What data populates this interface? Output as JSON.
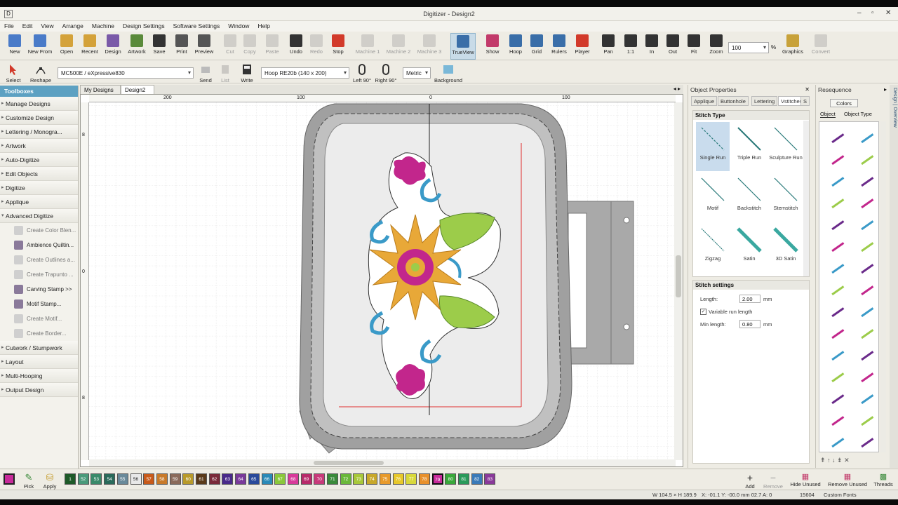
{
  "window": {
    "title": "Digitizer - Design2",
    "minimize": "–",
    "maximize": "▫",
    "close": "✕"
  },
  "menu": [
    "File",
    "Edit",
    "View",
    "Arrange",
    "Machine",
    "Design Settings",
    "Software Settings",
    "Window",
    "Help"
  ],
  "toolbar": [
    {
      "label": "New",
      "icon": "new-icon",
      "color": "#4a7bc8"
    },
    {
      "label": "New From",
      "icon": "new-from-icon",
      "color": "#4a7bc8"
    },
    {
      "label": "Open",
      "icon": "open-folder-icon",
      "color": "#d4a23a"
    },
    {
      "label": "Recent",
      "icon": "recent-icon",
      "color": "#d4a23a"
    },
    {
      "label": "Design",
      "icon": "design-icon",
      "color": "#7a5aa8"
    },
    {
      "label": "Artwork",
      "icon": "artwork-icon",
      "color": "#5a8a3a"
    },
    {
      "label": "Save",
      "icon": "save-icon",
      "color": "#333333"
    },
    {
      "label": "Print",
      "icon": "print-icon",
      "color": "#555555"
    },
    {
      "label": "Preview",
      "icon": "preview-icon",
      "color": "#555555"
    },
    {
      "label": "Cut",
      "icon": "cut-icon",
      "color": "#999999",
      "disabled": true
    },
    {
      "label": "Copy",
      "icon": "copy-icon",
      "color": "#999999",
      "disabled": true
    },
    {
      "label": "Paste",
      "icon": "paste-icon",
      "color": "#999999",
      "disabled": true
    },
    {
      "label": "Undo",
      "icon": "undo-icon",
      "color": "#333333"
    },
    {
      "label": "Redo",
      "icon": "redo-icon",
      "color": "#999999",
      "disabled": true
    },
    {
      "label": "Stop",
      "icon": "stop-icon",
      "color": "#d23a2a"
    },
    {
      "label": "Machine 1",
      "icon": "machine-icon",
      "color": "#999999",
      "disabled": true
    },
    {
      "label": "Machine 2",
      "icon": "machine-icon",
      "color": "#999999",
      "disabled": true
    },
    {
      "label": "Machine 3",
      "icon": "machine-icon",
      "color": "#999999",
      "disabled": true
    },
    {
      "label": "TrueView",
      "icon": "trueview-icon",
      "color": "#3a6ea8",
      "active": true
    },
    {
      "label": "Show",
      "icon": "show-icon",
      "color": "#c23a6a"
    },
    {
      "label": "Hoop",
      "icon": "hoop-icon",
      "color": "#3a6ea8"
    },
    {
      "label": "Grid",
      "icon": "grid-icon",
      "color": "#3a6ea8"
    },
    {
      "label": "Rulers",
      "icon": "rulers-icon",
      "color": "#3a6ea8"
    },
    {
      "label": "Player",
      "icon": "player-icon",
      "color": "#d23a2a"
    },
    {
      "label": "Pan",
      "icon": "pan-hand-icon",
      "color": "#333333"
    },
    {
      "label": "1:1",
      "icon": "zoom-actual-icon",
      "color": "#333333"
    },
    {
      "label": "In",
      "icon": "zoom-in-icon",
      "color": "#333333"
    },
    {
      "label": "Out",
      "icon": "zoom-out-icon",
      "color": "#333333"
    },
    {
      "label": "Fit",
      "icon": "zoom-fit-icon",
      "color": "#333333"
    },
    {
      "label": "Zoom",
      "icon": "zoom-icon",
      "color": "#333333"
    },
    {
      "label": "Graphics",
      "icon": "graphics-icon",
      "color": "#c8a23a"
    },
    {
      "label": "Convert",
      "icon": "convert-icon",
      "color": "#999999",
      "disabled": true
    }
  ],
  "zoom_value": "100",
  "zoom_unit": "%",
  "toolbar2": {
    "select_label": "Select",
    "reshape_label": "Reshape",
    "machine_combo": "MC500E / eXpressive830",
    "send_label": "Send",
    "list_label": "List",
    "write_label": "Write",
    "hoop_combo": "Hoop RE20b (140 x 200)",
    "left90_label": "Left 90°",
    "right90_label": "Right 90°",
    "units_combo": "Metric",
    "background_label": "Background"
  },
  "toolbox": {
    "header": "Toolboxes",
    "categories_top": [
      "Manage Designs",
      "Customize Design",
      "Lettering / Monogra...",
      "Artwork",
      "Auto-Digitize",
      "Edit Objects",
      "Digitize",
      "Applique"
    ],
    "advanced": "Advanced Digitize",
    "advanced_items": [
      {
        "label": "Create Color Blen...",
        "icon": "color-blend-icon",
        "enabled": false
      },
      {
        "label": "Ambience Quiltin...",
        "icon": "quilting-icon",
        "enabled": true
      },
      {
        "label": "Create Outlines a...",
        "icon": "outlines-icon",
        "enabled": false
      },
      {
        "label": "Create Trapunto ...",
        "icon": "trapunto-icon",
        "enabled": false
      },
      {
        "label": "Carving Stamp >>",
        "icon": "carving-stamp-icon",
        "enabled": true
      },
      {
        "label": "Motif Stamp...",
        "icon": "motif-stamp-icon",
        "enabled": true
      },
      {
        "label": "Create Motif...",
        "icon": "create-motif-icon",
        "enabled": false
      },
      {
        "label": "Create Border...",
        "icon": "create-border-icon",
        "enabled": false
      }
    ],
    "categories_bottom": [
      "Cutwork / Stumpwork",
      "Layout",
      "Multi-Hooping",
      "Output Design"
    ]
  },
  "doc_tabs": [
    {
      "label": "My Designs"
    },
    {
      "label": "Design2",
      "active": true
    }
  ],
  "ruler_labels": [
    "200",
    "100",
    "0",
    "100"
  ],
  "ruler_v_labels": [
    "8",
    "0",
    "8"
  ],
  "object_properties": {
    "title": "Object Properties",
    "tabs": [
      "Applique",
      "Buttonhole",
      "Lettering",
      "Vstitches",
      "S"
    ],
    "stitch_type_title": "Stitch Type",
    "stitch_types": [
      {
        "label": "Single Run",
        "selected": true
      },
      {
        "label": "Triple Run"
      },
      {
        "label": "Sculpture Run"
      },
      {
        "label": "Motif"
      },
      {
        "label": "Backstitch"
      },
      {
        "label": "Stemstitch"
      },
      {
        "label": "Zigzag"
      },
      {
        "label": "Satin"
      },
      {
        "label": "3D Satin"
      }
    ],
    "settings_title": "Stitch settings",
    "length_label": "Length:",
    "length_value": "2.00",
    "length_unit": "mm",
    "variable_label": "Variable run length",
    "min_length_label": "Min length:",
    "min_length_value": "0.80",
    "min_length_unit": "mm"
  },
  "resequence": {
    "title": "Resequence",
    "colors_btn": "Colors",
    "tab_object": "Object",
    "tab_type": "Object Type"
  },
  "sidebar_labels": "Design | Overview",
  "colors": [
    {
      "num": "1",
      "hex": "#1e5a28"
    },
    {
      "num": "52",
      "hex": "#4a9a7a"
    },
    {
      "num": "53",
      "hex": "#3a8a6a"
    },
    {
      "num": "54",
      "hex": "#2a6a5a"
    },
    {
      "num": "55",
      "hex": "#6a8a9a"
    },
    {
      "num": "56",
      "hex": "#e8e8e8"
    },
    {
      "num": "57",
      "hex": "#c85a1a"
    },
    {
      "num": "58",
      "hex": "#c87a2a"
    },
    {
      "num": "59",
      "hex": "#8a6a5a"
    },
    {
      "num": "60",
      "hex": "#b89a2a"
    },
    {
      "num": "61",
      "hex": "#5a3a1a"
    },
    {
      "num": "62",
      "hex": "#7a2a3a"
    },
    {
      "num": "63",
      "hex": "#4a2a8a"
    },
    {
      "num": "64",
      "hex": "#7a3a9a"
    },
    {
      "num": "65",
      "hex": "#2a4a9a"
    },
    {
      "num": "66",
      "hex": "#2a8ab8"
    },
    {
      "num": "67",
      "hex": "#8ac83a"
    },
    {
      "num": "68",
      "hex": "#d83a9a"
    },
    {
      "num": "69",
      "hex": "#b82a6a"
    },
    {
      "num": "70",
      "hex": "#c83a7a"
    },
    {
      "num": "71",
      "hex": "#3a8a3a"
    },
    {
      "num": "72",
      "hex": "#6ab83a"
    },
    {
      "num": "73",
      "hex": "#a8c83a"
    },
    {
      "num": "74",
      "hex": "#c8a82a"
    },
    {
      "num": "75",
      "hex": "#e89a2a"
    },
    {
      "num": "76",
      "hex": "#e8c82a"
    },
    {
      "num": "77",
      "hex": "#d8d83a"
    },
    {
      "num": "78",
      "hex": "#e8902a"
    },
    {
      "num": "79",
      "hex": "#c82a9a",
      "selected": true
    },
    {
      "num": "80",
      "hex": "#3aa83a"
    },
    {
      "num": "81",
      "hex": "#2a9a5a"
    },
    {
      "num": "82",
      "hex": "#3a7ab8"
    },
    {
      "num": "83",
      "hex": "#8a3a9a"
    }
  ],
  "bottom": {
    "pick_label": "Pick",
    "apply_label": "Apply",
    "add_label": "Add",
    "remove_label": "Remove",
    "hide_unused_label": "Hide Unused",
    "remove_unused_label": "Remove Unused",
    "threads_label": "Threads"
  },
  "status": {
    "size": "W 104.5 × H 189.9",
    "coords": "X: -01.1 Y: -00.0 mm 02.7 A: 0",
    "count": "15604",
    "font": "Custom Fonts"
  }
}
